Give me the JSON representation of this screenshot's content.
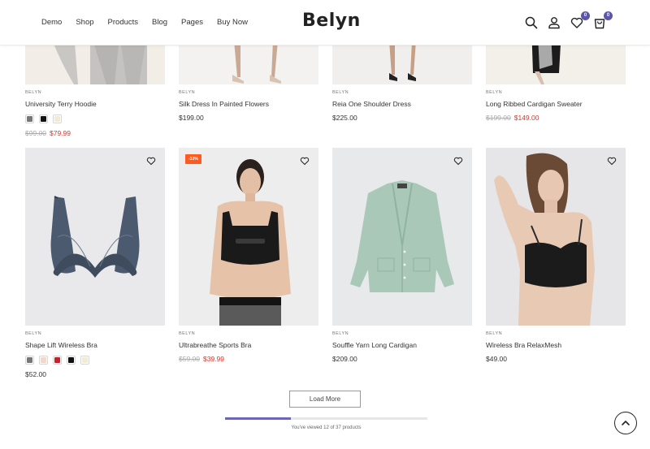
{
  "header": {
    "logo": "Belyn",
    "nav": [
      "Demo",
      "Shop",
      "Products",
      "Blog",
      "Pages",
      "Buy Now"
    ],
    "wishlist_count": "0",
    "cart_count": "0",
    "badge_color": "#5b57a5"
  },
  "products_top": [
    {
      "brand": "BELYN",
      "name": "University Terry Hoodie",
      "old_price": "$99.00",
      "price": "$79.99",
      "swatches": [
        "#777777",
        "#111111",
        "#f3ead4"
      ]
    },
    {
      "brand": "BELYN",
      "name": "Silk Dress In Painted Flowers",
      "old_price": "",
      "price": "$199.00",
      "swatches": []
    },
    {
      "brand": "BELYN",
      "name": "Reia One Shoulder Dress",
      "old_price": "",
      "price": "$225.00",
      "swatches": []
    },
    {
      "brand": "BELYN",
      "name": "Long Ribbed Cardigan Sweater",
      "old_price": "$199.00",
      "price": "$149.00",
      "swatches": []
    }
  ],
  "products_bottom": [
    {
      "brand": "BELYN",
      "name": "Shape Lift Wireless Bra",
      "old_price": "",
      "price": "$52.00",
      "badge": "",
      "swatches": [
        "#777777",
        "#f0d8cc",
        "#c8202c",
        "#111111",
        "#f3ead4"
      ]
    },
    {
      "brand": "BELYN",
      "name": "Ultrabreathe Sports Bra",
      "old_price": "$59.00",
      "price": "$39.99",
      "badge": "-33%",
      "swatches": []
    },
    {
      "brand": "BELYN",
      "name": "Souffle Yarn Long Cardigan",
      "old_price": "",
      "price": "$209.00",
      "badge": "",
      "swatches": []
    },
    {
      "brand": "BELYN",
      "name": "Wireless Bra RelaxMesh",
      "old_price": "",
      "price": "$49.00",
      "badge": "",
      "swatches": []
    }
  ],
  "pagination": {
    "load_more_label": "Load More",
    "viewed_text": "You've viewed 12 of 37 products",
    "progress_fraction": 0.324
  },
  "colors": {
    "sale_red": "#d7372e",
    "sale_badge": "#ff5a1f",
    "progress": "#6c67b5"
  }
}
